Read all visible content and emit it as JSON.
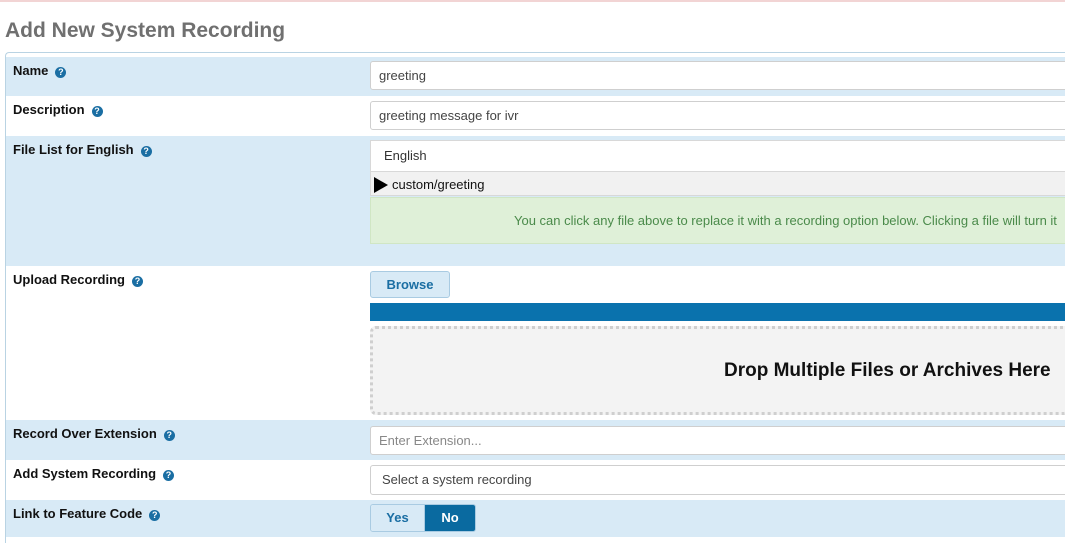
{
  "page": {
    "title": "Add New System Recording"
  },
  "form": {
    "name": {
      "label": "Name",
      "value": "greeting"
    },
    "description": {
      "label": "Description",
      "value": "greeting message for ivr"
    },
    "file_list": {
      "label": "File List for English",
      "language": "English",
      "files": [
        "custom/greeting"
      ],
      "info": "You can click any file above to replace it with a recording option below. Clicking a file will turn it"
    },
    "upload": {
      "label": "Upload Recording",
      "browse_label": "Browse",
      "progress": 1.0,
      "drop_text": "Drop Multiple Files or Archives Here"
    },
    "record_over_extension": {
      "label": "Record Over Extension",
      "placeholder": "Enter Extension..."
    },
    "add_system_recording": {
      "label": "Add System Recording",
      "selected": "Select a system recording"
    },
    "feature_code": {
      "label": "Link to Feature Code",
      "yes_label": "Yes",
      "no_label": "No",
      "selected": "No"
    }
  },
  "colors": {
    "row_shade": "#d8eaf6",
    "accent": "#0a72ad",
    "info_bg": "#dff0d8",
    "info_text": "#4a8a4a"
  }
}
